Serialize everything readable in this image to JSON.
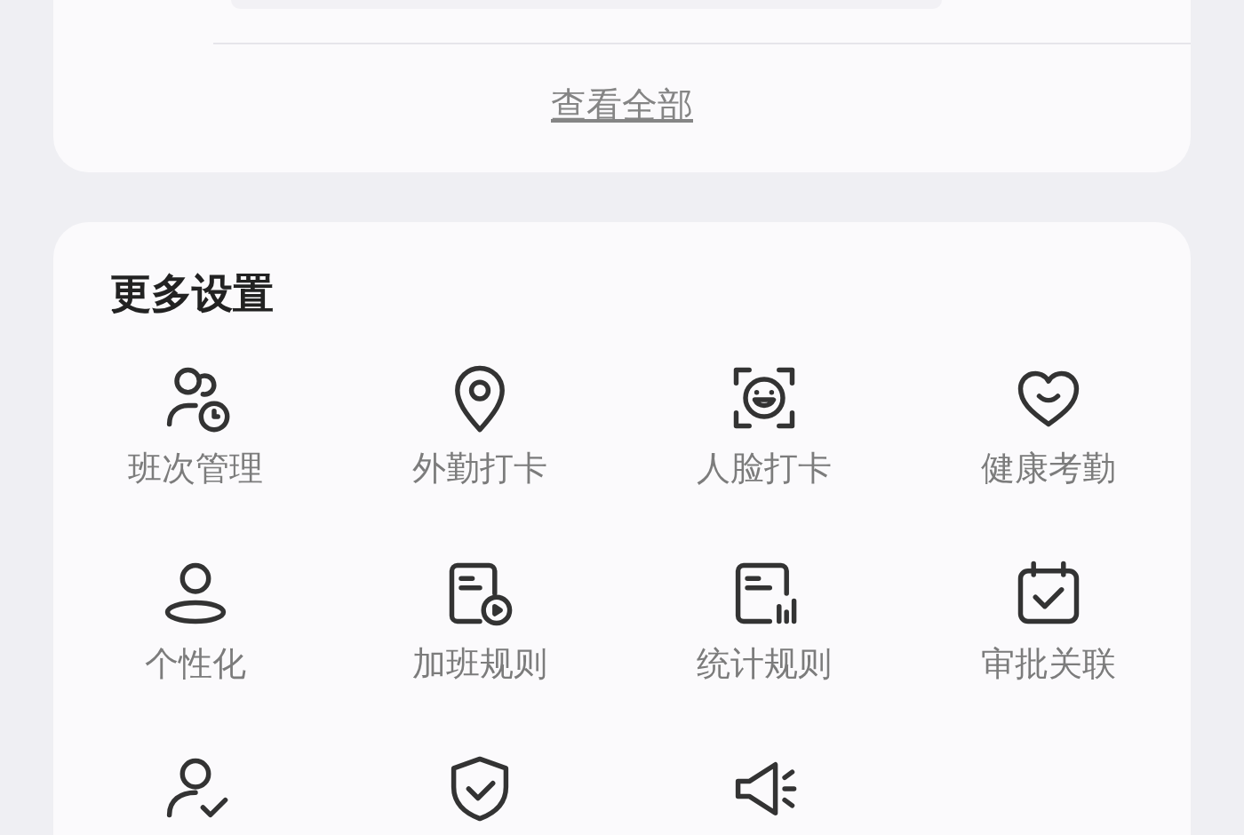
{
  "top_card": {
    "link": "查看全部"
  },
  "more_settings": {
    "title": "更多设置",
    "items": [
      {
        "label": "班次管理"
      },
      {
        "label": "外勤打卡"
      },
      {
        "label": "人脸打卡"
      },
      {
        "label": "健康考勤"
      },
      {
        "label": "个性化"
      },
      {
        "label": "加班规则"
      },
      {
        "label": "统计规则"
      },
      {
        "label": "审批关联"
      }
    ]
  }
}
